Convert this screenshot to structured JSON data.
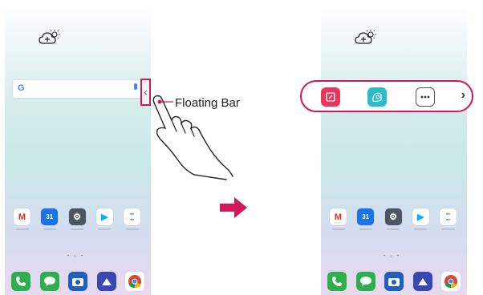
{
  "callout": {
    "label": "Floating Bar"
  },
  "floating_tab": {
    "chevron": "‹"
  },
  "floating_bar": {
    "items": [
      "note-icon",
      "smart-doctor-icon",
      "more-icon"
    ],
    "expand_chevron": "›"
  },
  "search": {
    "logo": "G"
  },
  "home_apps": [
    "Gmail",
    "Calendar",
    "Settings",
    "Play Store",
    "Google"
  ],
  "dock_apps": [
    "Phone",
    "Messages",
    "Camera",
    "Gallery",
    "Chrome"
  ],
  "pager": {
    "dots": "• ○ •"
  },
  "colors": {
    "highlight": "#d1195a",
    "arrow": "#d1195a"
  }
}
